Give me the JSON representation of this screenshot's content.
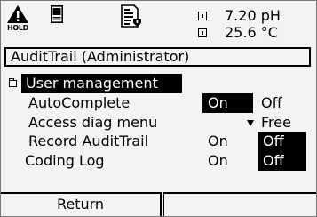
{
  "status": {
    "hold_label": "HOLD",
    "ph_value": "7.20 pH",
    "temp_value": "25.6 °C"
  },
  "title": "AuditTrail (Administrator)",
  "menu": {
    "selected": "User management",
    "rows": [
      {
        "label": "AutoComplete",
        "on": "On",
        "off": "Off",
        "active": "on"
      },
      {
        "label": "Access diag menu",
        "option": "Free",
        "active": "dropdown"
      },
      {
        "label": "Record AuditTrail",
        "on": "On",
        "off": "Off",
        "active": "off"
      },
      {
        "label": "Coding Log",
        "on": "On",
        "off": "Off",
        "active": "off"
      }
    ]
  },
  "softkeys": {
    "left": "Return",
    "right": ""
  }
}
